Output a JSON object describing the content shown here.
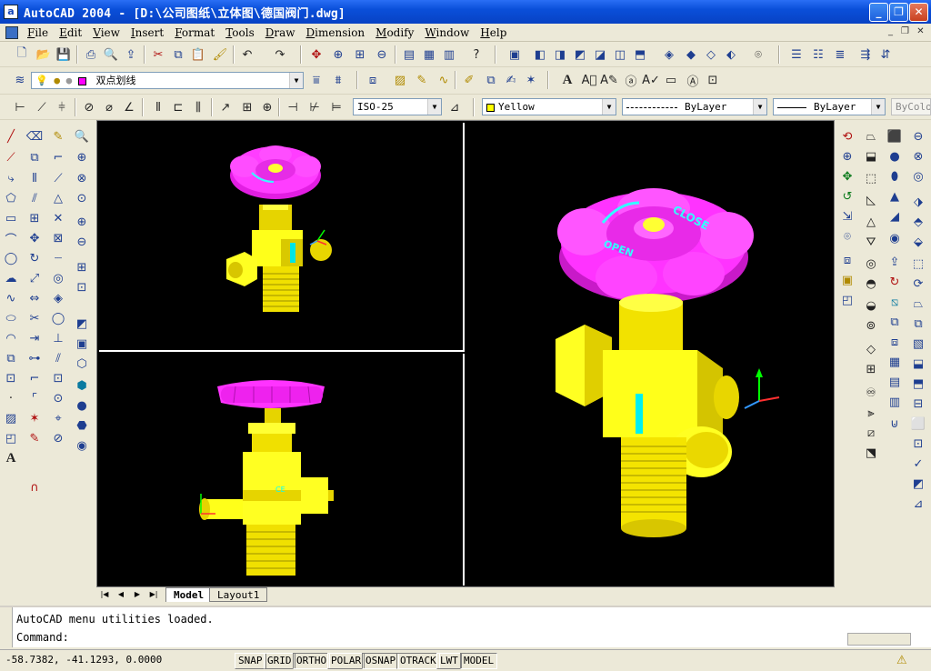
{
  "window": {
    "title": "AutoCAD 2004 - [D:\\公司图纸\\立体图\\德国阀门.dwg]",
    "app_icon_letter": "a",
    "buttons": [
      "minimize",
      "maximize",
      "close"
    ]
  },
  "menu": {
    "items": [
      "File",
      "Edit",
      "View",
      "Insert",
      "Format",
      "Tools",
      "Draw",
      "Dimension",
      "Modify",
      "Window",
      "Help"
    ]
  },
  "layer_toolbar": {
    "layer_name": "双点划线",
    "layer_color": "#ff00ff"
  },
  "dimension_toolbar": {
    "dim_style": "ISO-25"
  },
  "properties_toolbar": {
    "color": "Yellow",
    "color_swatch": "#ffff00",
    "linetype": "ByLayer",
    "lineweight": "ByLayer",
    "plotstyle": "ByColor"
  },
  "viewports": {
    "left_top_view": "isometric",
    "left_bottom_view": "front",
    "right_view": "isometric enlarged",
    "handwheel_text": [
      "CLOSE",
      "OPEN"
    ],
    "model_colors": {
      "handwheel": "#ff33ff",
      "body": "#ffff00",
      "text": "#00ffff",
      "background": "#000000"
    }
  },
  "layout_tabs": {
    "model": "Model",
    "layout1": "Layout1"
  },
  "command": {
    "history": "AutoCAD menu utilities loaded.",
    "prompt": "Command:"
  },
  "status": {
    "coords": "-58.7382, -41.1293, 0.0000",
    "buttons": [
      {
        "label": "SNAP",
        "on": false
      },
      {
        "label": "GRID",
        "on": false
      },
      {
        "label": "ORTHO",
        "on": true
      },
      {
        "label": "POLAR",
        "on": false
      },
      {
        "label": "OSNAP",
        "on": true
      },
      {
        "label": "OTRACK",
        "on": true
      },
      {
        "label": "LWT",
        "on": false
      },
      {
        "label": "MODEL",
        "on": true
      }
    ]
  }
}
